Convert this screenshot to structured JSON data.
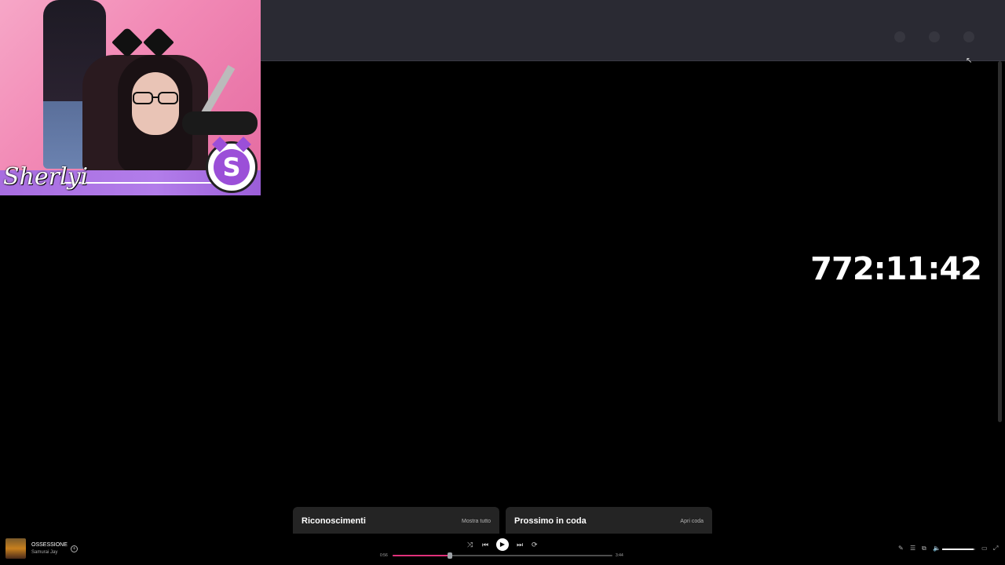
{
  "webcam": {
    "streamer_name": "Sherlyi",
    "logo_letter": "S"
  },
  "timer": "772:11:42",
  "cards": {
    "credits": {
      "title": "Riconoscimenti",
      "link": "Mostra tutto"
    },
    "queue": {
      "title": "Prossimo in coda",
      "link": "Apri coda"
    }
  },
  "player": {
    "track_title": "OSSESSIONE",
    "artist": "Samurai Jay",
    "elapsed": "0:56",
    "duration": "3:44",
    "progress_percent": 26,
    "volume_percent": 95,
    "accent_color": "#e0317a"
  },
  "icons": {
    "add": "+",
    "shuffle": "⤨",
    "previous": "⏮",
    "play": "▶",
    "next": "⏭",
    "repeat": "⟳",
    "lyrics": "✎",
    "queue": "☰",
    "devices": "⧉",
    "volume": "🔈",
    "miniplayer": "▭",
    "fullscreen": "⤢",
    "cursor": "↖"
  }
}
